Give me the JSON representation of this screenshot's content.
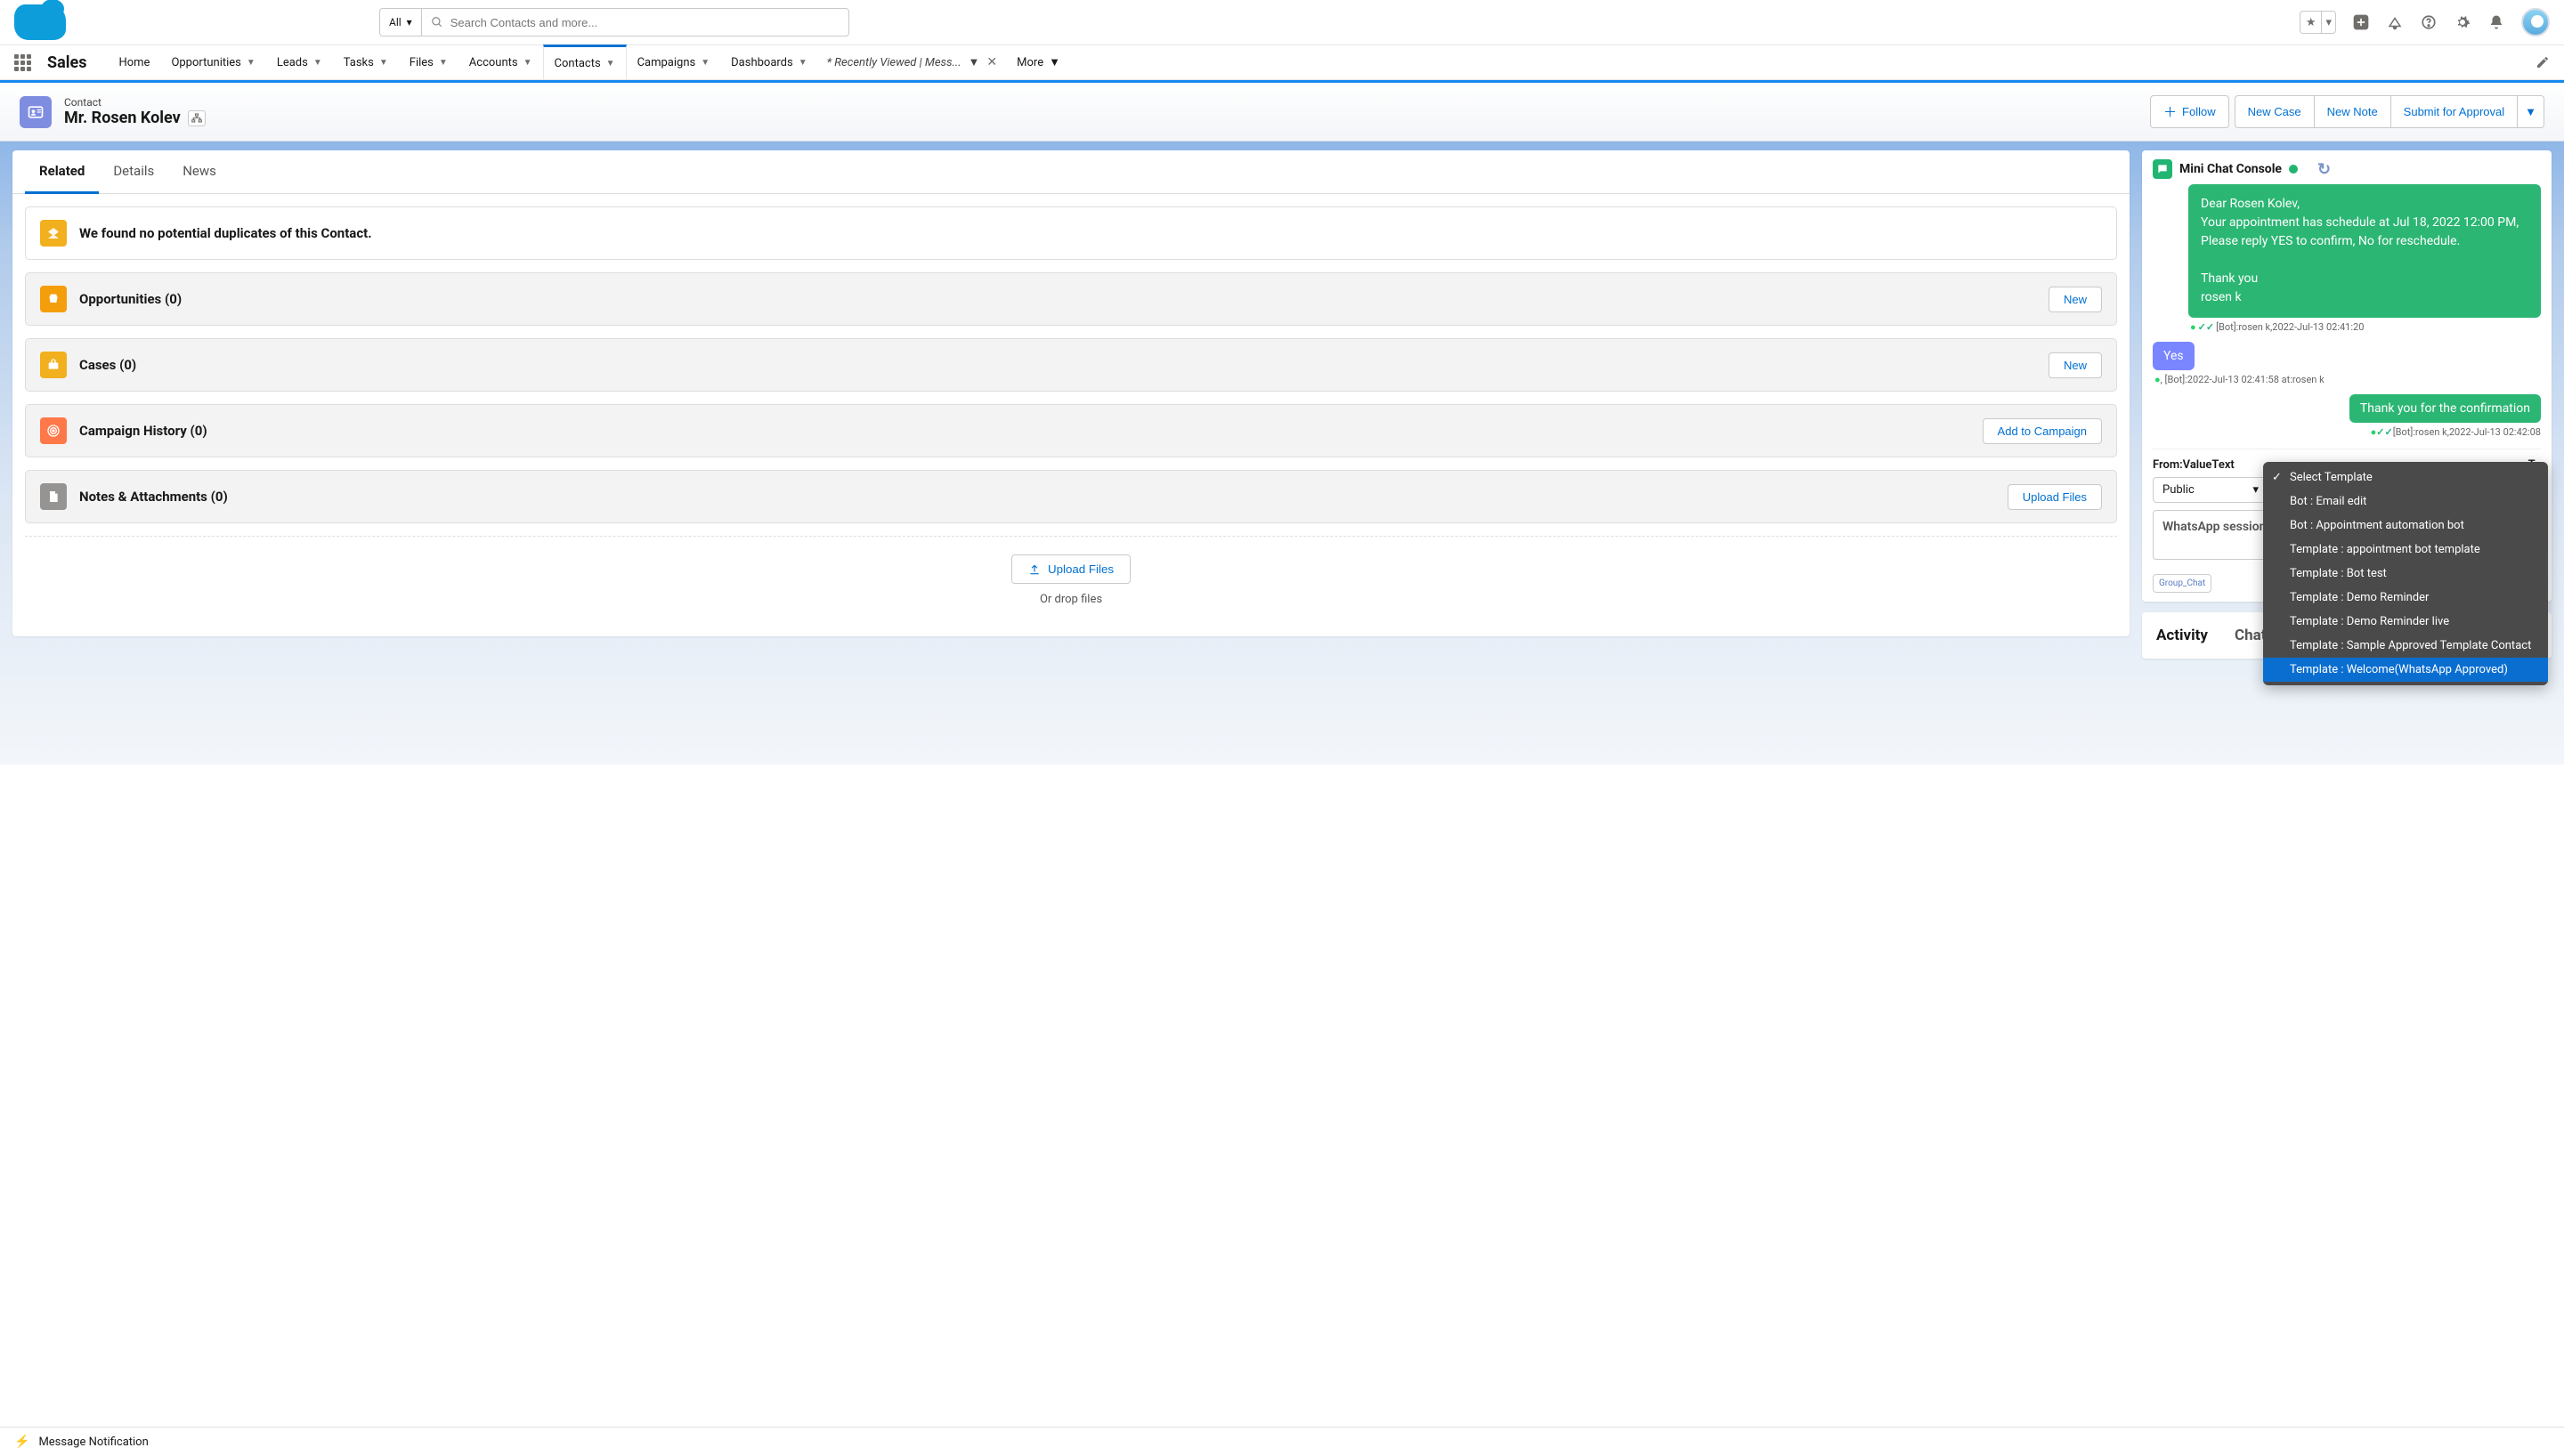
{
  "header": {
    "search_filter": "All",
    "search_placeholder": "Search Contacts and more..."
  },
  "nav": {
    "app": "Sales",
    "items": [
      "Home",
      "Opportunities",
      "Leads",
      "Tasks",
      "Files",
      "Accounts",
      "Contacts",
      "Campaigns",
      "Dashboards"
    ],
    "extra_tab": "* Recently Viewed | Mess...",
    "more": "More"
  },
  "page_header": {
    "entity_label": "Contact",
    "title": "Mr. Rosen Kolev",
    "actions": {
      "follow": "Follow",
      "new_case": "New Case",
      "new_note": "New Note",
      "submit": "Submit for Approval"
    }
  },
  "tabs": {
    "related": "Related",
    "details": "Details",
    "news": "News"
  },
  "related": {
    "dup_msg": "We found no potential duplicates of this Contact.",
    "opps": "Opportunities (0)",
    "cases": "Cases (0)",
    "camp_hist": "Campaign History (0)",
    "notes": "Notes & Attachments (0)",
    "new_btn": "New",
    "add_campaign": "Add to Campaign",
    "upload_files": "Upload Files",
    "or_drop": "Or drop files"
  },
  "chat": {
    "title": "Mini Chat Console",
    "msg1_l1": "Dear Rosen Kolev,",
    "msg1_l2": "Your appointment has schedule at Jul 18, 2022 12:00 PM,",
    "msg1_l3": "Please reply YES to confirm, No for reschedule.",
    "msg1_l4": "Thank you",
    "msg1_l5": "rosen k",
    "meta1": "[Bot]:rosen k,2022-Jul-13 02:41:20",
    "msg2": "Yes",
    "meta2": ", [Bot]:2022-Jul-13 02:41:58 at:rosen k",
    "msg3": "Thank you for the confirmation",
    "meta3": "[Bot]:rosen k,2022-Jul-13 02:42:08",
    "from_label": "From:ValueText",
    "to_label": "To",
    "public": "Public",
    "session_txt": "WhatsApp session initiate the convers",
    "group_chat": "Group_Chat"
  },
  "dropdown": {
    "items": [
      "Select Template",
      "Bot : Email edit",
      "Bot : Appointment automation bot",
      "Template : appointment bot template",
      "Template : Bot test",
      "Template : Demo Reminder",
      "Template : Demo Reminder live",
      "Template : Sample Approved Template Contact",
      "Template : Welcome(WhatsApp Approved)"
    ]
  },
  "activity": {
    "activity": "Activity",
    "chatter": "Chatter"
  },
  "footer": {
    "msg": "Message Notification"
  }
}
